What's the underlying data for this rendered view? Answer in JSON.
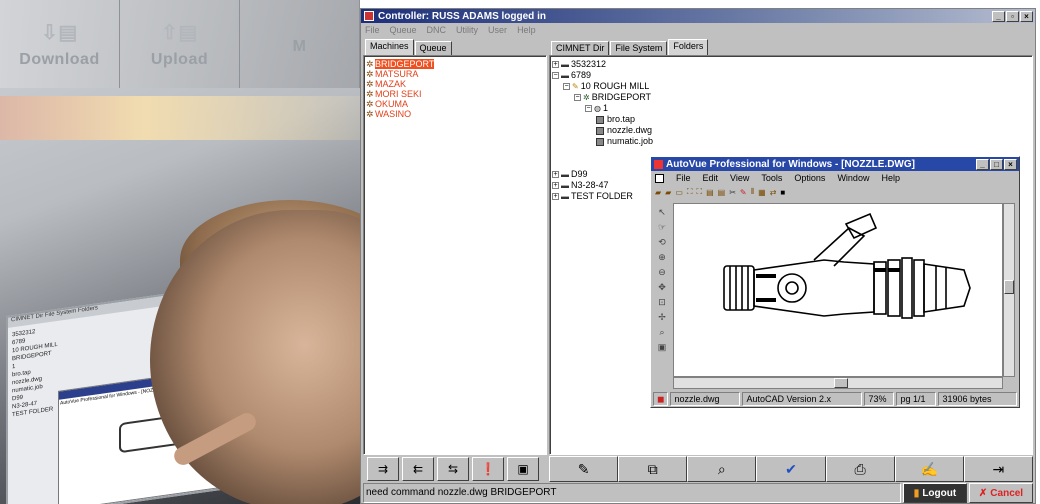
{
  "left_banner": {
    "nav": [
      {
        "label": "Download",
        "icon": "download-icon"
      },
      {
        "label": "Upload",
        "icon": "upload-icon"
      },
      {
        "label": "M",
        "icon": "machine-icon"
      }
    ],
    "monitor_text": {
      "tabs": "CIMNET Dir   File System   Folders",
      "tree": [
        "3532312",
        "6789",
        "10 ROUGH MILL",
        "BRIDGEPORT",
        "1",
        "bro.tap",
        "nozzle.dwg",
        "numatic.job",
        "D99",
        "N3-28-47",
        "TEST FOLDER"
      ],
      "window_title": "AutoVue Professional for Windows - [NOZZLE.DWG]"
    }
  },
  "window": {
    "title": "Controller: RUSS ADAMS logged in",
    "menu": [
      "File",
      "Queue",
      "DNC",
      "Utility",
      "User",
      "Help"
    ],
    "left_tabs": [
      "Machines",
      "Queue"
    ],
    "right_tabs": [
      "CIMNET Dir",
      "File System",
      "Folders"
    ],
    "machines": [
      {
        "name": "BRIDGEPORT",
        "selected": true
      },
      {
        "name": "MATSURA",
        "selected": false
      },
      {
        "name": "MAZAK",
        "selected": false
      },
      {
        "name": "MORI SEKI",
        "selected": false
      },
      {
        "name": "OKUMA",
        "selected": false
      },
      {
        "name": "WASINO",
        "selected": false
      }
    ],
    "tree": [
      {
        "label": "3532312",
        "depth": 0,
        "expander": "+",
        "icon": "folder-icon"
      },
      {
        "label": "6789",
        "depth": 0,
        "expander": "-",
        "icon": "folder-icon"
      },
      {
        "label": "10 ROUGH MILL",
        "depth": 1,
        "expander": "-",
        "icon": "pencil-icon"
      },
      {
        "label": "BRIDGEPORT",
        "depth": 2,
        "expander": "-",
        "icon": "gear-icon"
      },
      {
        "label": "1",
        "depth": 3,
        "expander": "-",
        "icon": "globe-icon"
      },
      {
        "label": "bro.tap",
        "depth": 4,
        "expander": "",
        "icon": "document-icon"
      },
      {
        "label": "nozzle.dwg",
        "depth": 4,
        "expander": "",
        "icon": "document-icon"
      },
      {
        "label": "numatic.job",
        "depth": 4,
        "expander": "",
        "icon": "document-icon"
      },
      {
        "label": "D99",
        "depth": 0,
        "expander": "+",
        "icon": "folder-icon"
      },
      {
        "label": "N3-28-47",
        "depth": 0,
        "expander": "+",
        "icon": "folder-icon"
      },
      {
        "label": "TEST FOLDER",
        "depth": 0,
        "expander": "+",
        "icon": "folder-icon"
      }
    ],
    "left_toolbar_icons": [
      "send-icon",
      "receive-icon",
      "transfer-icon",
      "alert-icon",
      "monitor-icon"
    ],
    "right_toolbar_icons": [
      "edit-icon",
      "compare-icon",
      "search-icon",
      "check-icon",
      "print-icon",
      "notes-icon",
      "exit-icon"
    ],
    "status_message": "need command nozzle.dwg BRIDGEPORT",
    "logout_label": "Logout",
    "cancel_label": "Cancel"
  },
  "autovue": {
    "title": "AutoVue Professional for Windows - [NOZZLE.DWG]",
    "menu": [
      "File",
      "Edit",
      "View",
      "Tools",
      "Options",
      "Window",
      "Help"
    ],
    "status": {
      "file": "nozzle.dwg",
      "format": "AutoCAD Version 2.x",
      "zoom": "73%",
      "page": "pg 1/1",
      "size": "31906 bytes"
    }
  },
  "colors": {
    "titlebar": "#1c2f7a",
    "autovue_titlebar": "#2848a8",
    "machine_text": "#e2401a",
    "selection": "#f05020",
    "cancel_text": "#dd2222"
  }
}
